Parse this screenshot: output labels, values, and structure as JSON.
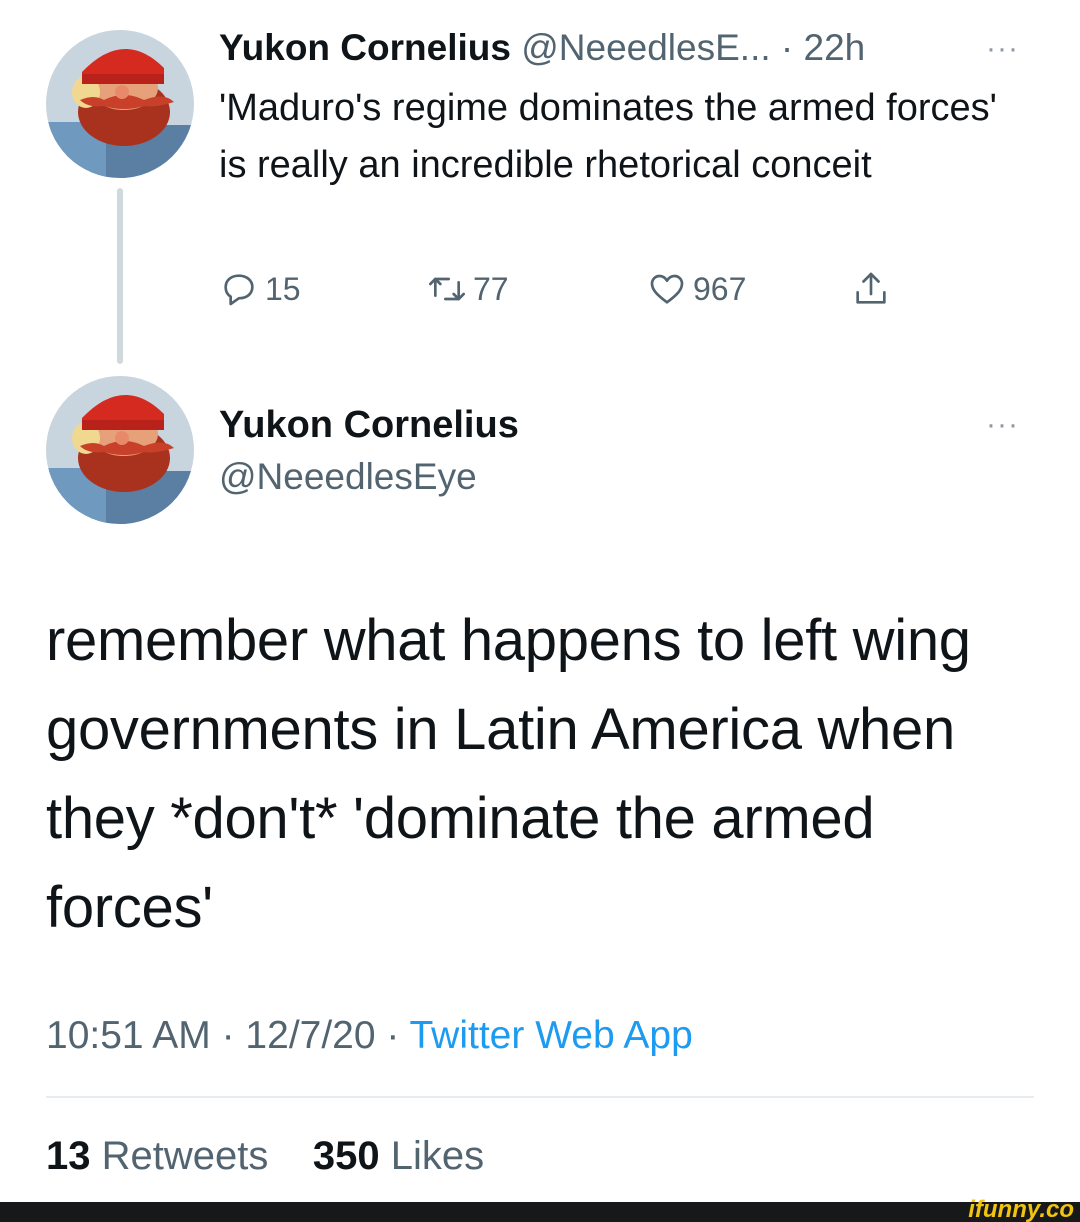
{
  "tweet1": {
    "name": "Yukon Cornelius",
    "handle": "@NeeedlesE...",
    "time": "· 22h",
    "more": "···",
    "text": "'Maduro's regime dominates the armed forces' is really an incredible rhetorical conceit",
    "replies": "15",
    "retweets": "77",
    "likes": "967"
  },
  "tweet2": {
    "name": "Yukon Cornelius",
    "handle": "@NeeedlesEye",
    "more": "···",
    "text": "remember what happens to left wing governments in Latin America when they *don't* 'dominate the armed forces'",
    "timestamp": "10:51 AM · 12/7/20 · ",
    "source": "Twitter Web App",
    "retweet_count": "13",
    "retweet_label": "Retweets",
    "like_count": "350",
    "like_label": "Likes"
  },
  "watermark": "ifunny.co",
  "icons": {
    "reply": "reply-icon",
    "retweet": "retweet-icon",
    "like": "heart-icon",
    "share": "share-icon",
    "more": "more-icon"
  },
  "colors": {
    "text": "#0f1419",
    "secondary": "#536471",
    "link": "#1d9bf0",
    "thread_line": "#cfd9de",
    "watermark": "#f2c40f"
  }
}
